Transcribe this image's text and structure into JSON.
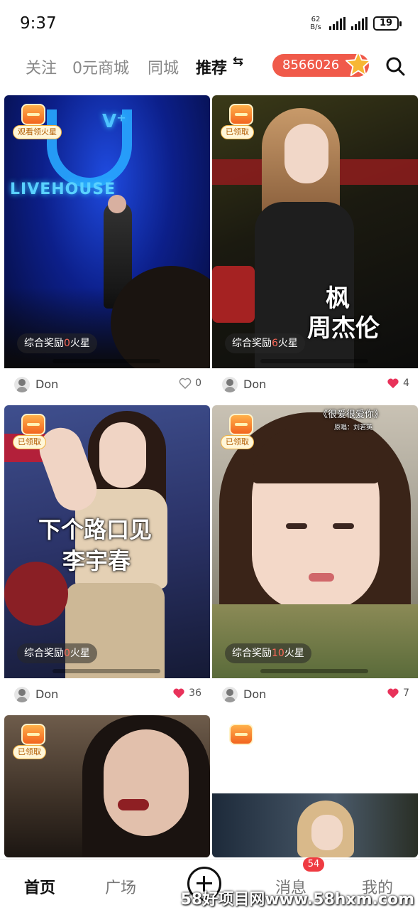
{
  "status_bar": {
    "time": "9:37",
    "net_speed_value": "62",
    "net_speed_unit": "B/s",
    "battery": "19"
  },
  "top_nav": {
    "tabs": [
      {
        "label": "关注"
      },
      {
        "label": "0元商城"
      },
      {
        "label": "同城"
      },
      {
        "label": "推荐"
      }
    ],
    "switch_icon": "⇆",
    "points": "8566026",
    "accent": "#f05a4a"
  },
  "feed": {
    "cards": [
      {
        "badge": "观看领火星",
        "reward_prefix": "综合奖励",
        "reward_value": "0",
        "reward_suffix": "火星",
        "progress": 0.0,
        "overlay_lines": [
          "V⁺",
          "LIVEHOUSE"
        ],
        "author": "Don",
        "likes": "0",
        "liked": false
      },
      {
        "badge": "已领取",
        "reward_prefix": "综合奖励",
        "reward_value": "6",
        "reward_suffix": "火星",
        "progress": 0.0,
        "overlay_lines": [
          "枫",
          "周杰伦"
        ],
        "author": "Don",
        "likes": "4",
        "liked": true
      },
      {
        "badge": "已领取",
        "reward_prefix": "综合奖励",
        "reward_value": "0",
        "reward_suffix": "火星",
        "progress": 0.0,
        "overlay_lines": [
          "下个路口见",
          "李宇春"
        ],
        "author": "Don",
        "likes": "36",
        "liked": true
      },
      {
        "badge": "已领取",
        "reward_prefix": "综合奖励",
        "reward_value": "10",
        "reward_suffix": "火星",
        "progress": 0.0,
        "overlay_lines": [
          "《很爱很爱你》",
          "原唱：刘若英"
        ],
        "author": "Don",
        "likes": "7",
        "liked": true
      },
      {
        "badge": "已领取"
      },
      {
        "badge": ""
      }
    ]
  },
  "bottom_nav": {
    "items": [
      {
        "label": "首页"
      },
      {
        "label": "广场"
      },
      {
        "label": "消息"
      },
      {
        "label": "我的"
      }
    ],
    "message_count": "54"
  },
  "watermark": "58好项目网www.58hxm.com"
}
